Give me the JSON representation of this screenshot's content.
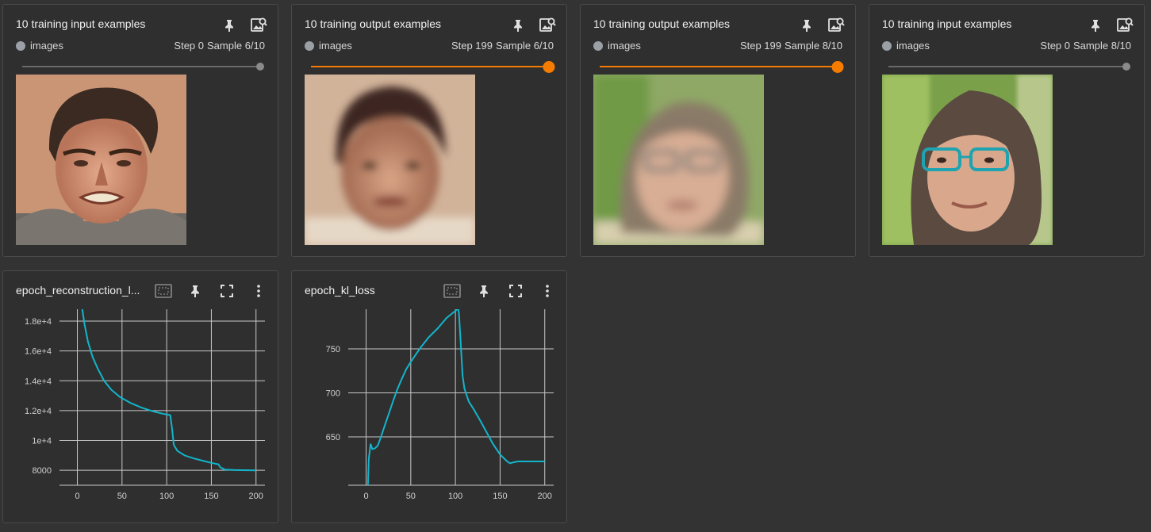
{
  "image_cards": [
    {
      "title": "10 training input examples",
      "run": "images",
      "step": "Step 0",
      "sample": "Sample 6/10",
      "slider_fraction": 1.0,
      "active": false
    },
    {
      "title": "10 training output examples",
      "run": "images",
      "step": "Step 199",
      "sample": "Sample 6/10",
      "slider_fraction": 1.0,
      "active": true
    },
    {
      "title": "10 training output examples",
      "run": "images",
      "step": "Step 199",
      "sample": "Sample 8/10",
      "slider_fraction": 1.0,
      "active": true
    },
    {
      "title": "10 training input examples",
      "run": "images",
      "step": "Step 0",
      "sample": "Sample 8/10",
      "slider_fraction": 1.0,
      "active": false
    }
  ],
  "colors": {
    "accent": "#f57c00",
    "series": "#12b5cb",
    "run_dot": "#9aa0a6"
  },
  "chart_cards": [
    {
      "title": "epoch_reconstruction_l..."
    },
    {
      "title": "epoch_kl_loss"
    }
  ],
  "chart_data": [
    {
      "type": "line",
      "title": "epoch_reconstruction_l...",
      "xlim": [
        -20,
        210
      ],
      "ylim": [
        7000,
        18800
      ],
      "xticks": [
        0,
        50,
        100,
        150,
        200
      ],
      "xtick_labels": [
        "0",
        "50",
        "100",
        "150",
        "200"
      ],
      "yticks": [
        8000,
        10000,
        12000,
        14000,
        16000,
        18000
      ],
      "ytick_labels": [
        "8000",
        "1e+4",
        "1.2e+4",
        "1.4e+4",
        "1.6e+4",
        "1.8e+4"
      ],
      "grid": true,
      "series": [
        {
          "x": [
            5,
            8,
            12,
            17,
            23,
            30,
            38,
            48,
            60,
            72,
            85,
            95,
            104,
            106,
            108,
            112,
            120,
            130,
            140,
            150,
            158,
            160,
            165,
            175,
            185,
            200
          ],
          "y": [
            19000,
            17800,
            16600,
            15600,
            14800,
            14000,
            13400,
            12900,
            12500,
            12200,
            11950,
            11800,
            11700,
            10800,
            9700,
            9300,
            9000,
            8800,
            8650,
            8500,
            8400,
            8200,
            8050,
            8020,
            8010,
            8000
          ]
        }
      ]
    },
    {
      "type": "line",
      "title": "epoch_kl_loss",
      "xlim": [
        -20,
        210
      ],
      "ylim": [
        595,
        795
      ],
      "xticks": [
        0,
        50,
        100,
        150,
        200
      ],
      "xtick_labels": [
        "0",
        "50",
        "100",
        "150",
        "200"
      ],
      "yticks": [
        650,
        700,
        750
      ],
      "ytick_labels": [
        "650",
        "700",
        "750"
      ],
      "grid": true,
      "series": [
        {
          "x": [
            2,
            3,
            5,
            7,
            10,
            13,
            16,
            20,
            25,
            30,
            35,
            40,
            45,
            50,
            60,
            70,
            80,
            90,
            96,
            100,
            103,
            104,
            106,
            108,
            110,
            115,
            120,
            128,
            135,
            142,
            150,
            158,
            161,
            165,
            170,
            180,
            200
          ],
          "y": [
            595,
            625,
            642,
            636,
            637,
            640,
            648,
            660,
            675,
            690,
            704,
            716,
            727,
            735,
            750,
            763,
            773,
            785,
            790,
            793,
            796,
            790,
            755,
            720,
            705,
            690,
            682,
            668,
            655,
            642,
            630,
            622,
            620,
            621,
            622,
            622,
            622
          ]
        }
      ]
    }
  ]
}
